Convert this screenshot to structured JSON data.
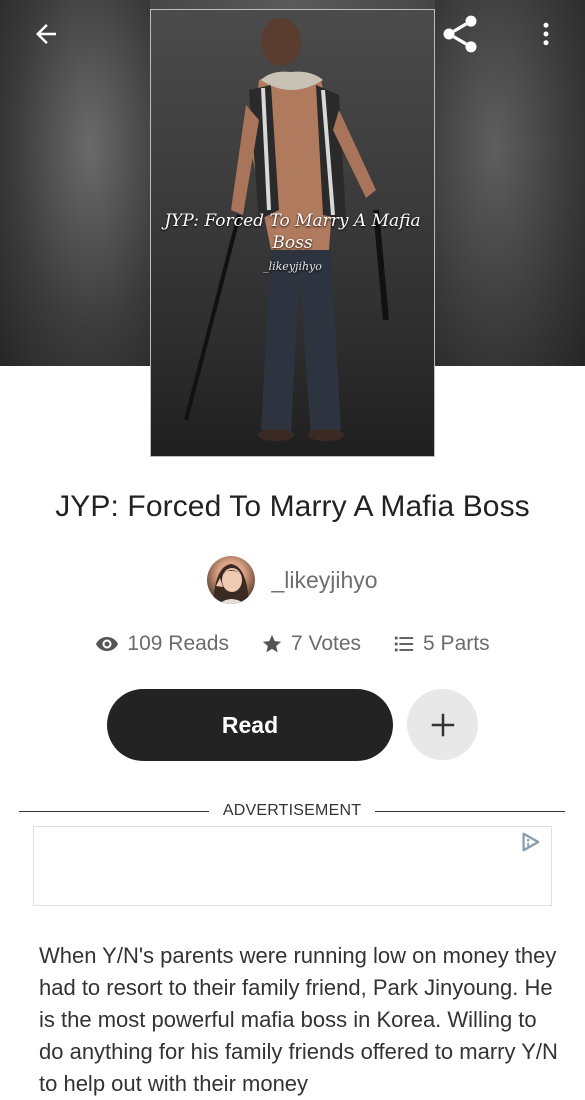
{
  "topbar": {
    "back_icon": "arrow-left-icon",
    "share_icon": "share-icon",
    "more_icon": "more-vertical-icon"
  },
  "cover": {
    "title": "JYP: Forced To Marry A Mafia Boss",
    "author_signature": "_likeyjihyo"
  },
  "story": {
    "title": "JYP: Forced To Marry A Mafia Boss",
    "author": "_likeyjihyo"
  },
  "stats": {
    "reads": "109 Reads",
    "votes": "7 Votes",
    "parts": "5 Parts"
  },
  "actions": {
    "read_label": "Read",
    "add_icon": "plus-icon"
  },
  "ad": {
    "label": "ADVERTISEMENT",
    "icon": "ad-choices-icon"
  },
  "description": {
    "text": "When Y/N's parents were running low on money they had to resort to their family friend, Park Jinyoung. He is the most powerful mafia boss in Korea. Willing to do anything for his family friends offered to marry Y/N to help out with their money"
  },
  "colors": {
    "primary_button": "#232323",
    "secondary_button": "#e8e8e8",
    "muted_text": "#6b6b6b"
  }
}
